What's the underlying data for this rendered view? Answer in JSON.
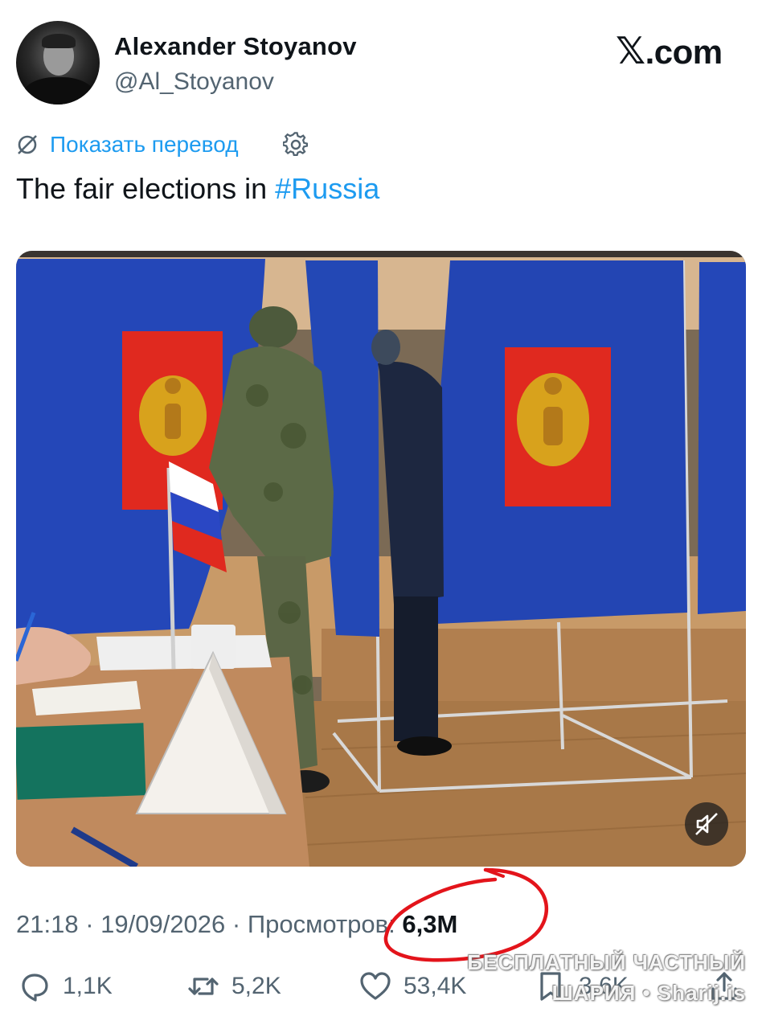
{
  "author": {
    "display_name": "Alexander Stoyanov",
    "handle": "@Al_Stoyanov"
  },
  "brand": {
    "logo_x": "𝕏",
    "logo_suffix": ".com"
  },
  "translate": {
    "label": "Показать перевод"
  },
  "tweet": {
    "text_prefix": "The fair elections in ",
    "hashtag": "#Russia"
  },
  "meta": {
    "time_date": "21:18 · 19/09/2026 · ",
    "views_label": "Просмотров: ",
    "views_count": "6,3M"
  },
  "actions": {
    "replies": "1,1K",
    "reposts": "5,2K",
    "likes": "53,4K",
    "bookmarks": "3,6K"
  },
  "watermark": {
    "line1": "БЕСПЛАТНЫЙ ЧАСТНЫЙ",
    "line2": "ШАРИЯ • Sharij.is"
  },
  "colors": {
    "link": "#1d9bf0",
    "secondary_text": "#536471",
    "curtain_blue": "#2447b8",
    "flag_red": "#e0291f",
    "annotation_red": "#e3141b"
  },
  "icons": [
    "translate-icon",
    "gear-icon",
    "mute-icon",
    "reply-icon",
    "retweet-icon",
    "like-icon",
    "bookmark-icon",
    "share-icon"
  ]
}
